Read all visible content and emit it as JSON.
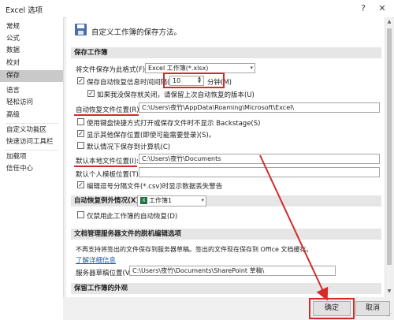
{
  "window": {
    "title": "Excel 选项",
    "help_glyph": "?",
    "close_glyph": "✕"
  },
  "sidebar": {
    "items": [
      {
        "label": "常规"
      },
      {
        "label": "公式"
      },
      {
        "label": "数据"
      },
      {
        "label": "校对"
      },
      {
        "label": "保存",
        "active": true
      },
      {
        "label": "语言"
      },
      {
        "label": "轻松访问"
      },
      {
        "label": "高级"
      },
      {
        "label": "自定义功能区"
      },
      {
        "label": "快速访问工具栏"
      },
      {
        "label": "加载项"
      },
      {
        "label": "信任中心"
      }
    ]
  },
  "header": {
    "title": "自定义工作簿的保存方法。",
    "icon": "save-disk-icon"
  },
  "save_workbooks": {
    "section_title": "保存工作簿",
    "format_label": "将文件保存为此格式(F):",
    "format_value": "Excel 工作簿(*.xlsx)",
    "autorecover_label": "保存自动恢复信息时间间隔(A)",
    "autorecover_checked": true,
    "autorecover_minutes": "10",
    "minutes_label": "分钟(M)",
    "keep_last_label": "如果我没保存就关闭，请保留上次自动恢复的版本(U)",
    "keep_last_checked": true,
    "autorecover_location_label": "自动恢复文件位置(R):",
    "autorecover_location_value": "C:\\Users\\夜竹\\AppData\\Roaming\\Microsoft\\Excel\\",
    "no_backstage_label": "使用键盘快捷方式打开或保存文件时不显示 Backstage(S)",
    "no_backstage_checked": false,
    "show_more_places_label": "显示其他保存位置(即使可能需要登录)(S)。",
    "show_more_places_checked": true,
    "default_computer_label": "默认情况下保存到计算机(C)",
    "default_computer_checked": false,
    "default_local_label": "默认本地文件位置(I):",
    "default_local_value": "C:\\Users\\夜竹\\Documents",
    "default_template_label": "默认个人模板位置(T):",
    "default_template_value": "",
    "csv_warning_label": "编辑逗号分隔文件(*.csv)时显示数据丢失警告",
    "csv_warning_checked": true
  },
  "autorecover_exceptions": {
    "section_title": "自动恢复例外情况(X):",
    "workbook_value": "工作簿1",
    "xls_icon_text": "X",
    "disable_label": "仅禁用此工作簿的自动恢复(D)",
    "disable_checked": false
  },
  "offline_editing": {
    "section_title": "文档管理服务器文件的脱机编辑选项",
    "note": "不再支持将签出的文件保存到服务器草稿。签出的文件现在保存到 Office 文档缓存。",
    "learn_more": "了解详细信息",
    "drafts_label": "服务器草稿位置(V):",
    "drafts_value": "C:\\Users\\夜竹\\Documents\\SharePoint 草稿\\"
  },
  "preserve_visual": {
    "section_title": "保留工作簿的外观"
  },
  "footer": {
    "ok_label": "确定",
    "cancel_label": "取消"
  },
  "colors": {
    "annotation_red": "#d42a2a",
    "active_item": "#c9c9c9",
    "section_bg": "#e6e6e6"
  }
}
